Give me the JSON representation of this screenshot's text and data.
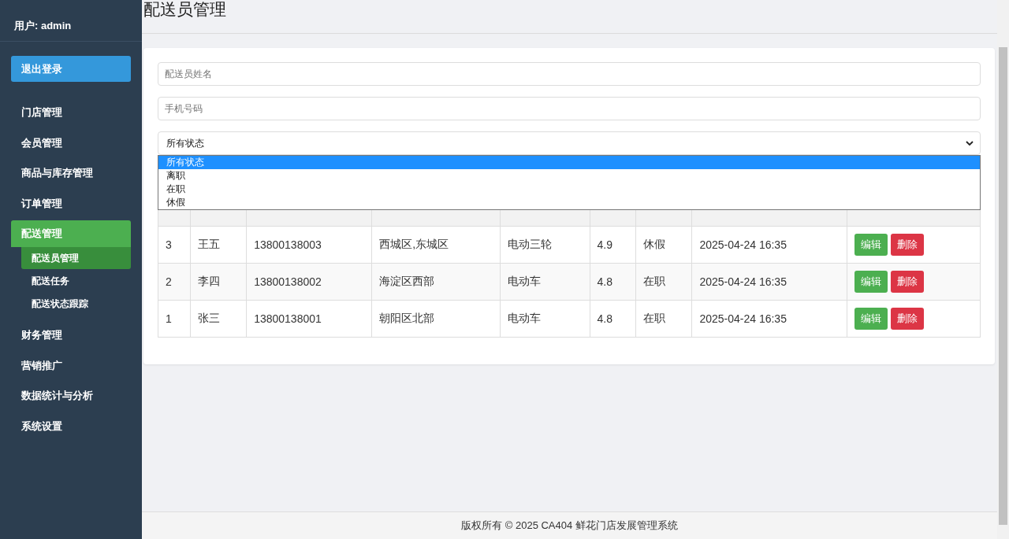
{
  "sidebar": {
    "user": "用户: admin",
    "logout": "退出登录",
    "items": [
      {
        "label": "门店管理",
        "selected": false
      },
      {
        "label": "会员管理",
        "selected": false
      },
      {
        "label": "商品与库存管理",
        "selected": false
      },
      {
        "label": "订单管理",
        "selected": false
      },
      {
        "label": "配送管理",
        "selected": true,
        "children": [
          {
            "label": "配送员管理",
            "selected": true
          },
          {
            "label": "配送任务",
            "selected": false
          },
          {
            "label": "配送状态跟踪",
            "selected": false
          }
        ]
      },
      {
        "label": "财务管理",
        "selected": false
      },
      {
        "label": "营销推广",
        "selected": false
      },
      {
        "label": "数据统计与分析",
        "selected": false
      },
      {
        "label": "系统设置",
        "selected": false
      }
    ]
  },
  "page_title": "配送员管理",
  "filters": {
    "name": {
      "placeholder": "配送员姓名"
    },
    "phone": {
      "placeholder": "手机号码"
    },
    "status": {
      "value": "所有状态",
      "expanded": true,
      "options": [
        {
          "label": "所有状态",
          "selected": true
        },
        {
          "label": "离职",
          "selected": false
        },
        {
          "label": "在职",
          "selected": false
        },
        {
          "label": "休假",
          "selected": false
        }
      ]
    }
  },
  "table": {
    "rows": [
      {
        "cells": [
          "3",
          "王五",
          "13800138003",
          "西城区,东城区",
          "电动三轮",
          "4.9",
          "休假",
          "2025-04-24 16:35"
        ],
        "actions": [
          "编辑",
          "删除"
        ]
      },
      {
        "cells": [
          "2",
          "李四",
          "13800138002",
          "海淀区西部",
          "电动车",
          "4.8",
          "在职",
          "2025-04-24 16:35"
        ],
        "actions": [
          "编辑",
          "删除"
        ]
      },
      {
        "cells": [
          "1",
          "张三",
          "13800138001",
          "朝阳区北部",
          "电动车",
          "4.8",
          "在职",
          "2025-04-24 16:35"
        ],
        "actions": [
          "编辑",
          "删除"
        ]
      }
    ]
  },
  "footer": "版权所有 © 2025 CA404 鲜花门店发展管理系统"
}
